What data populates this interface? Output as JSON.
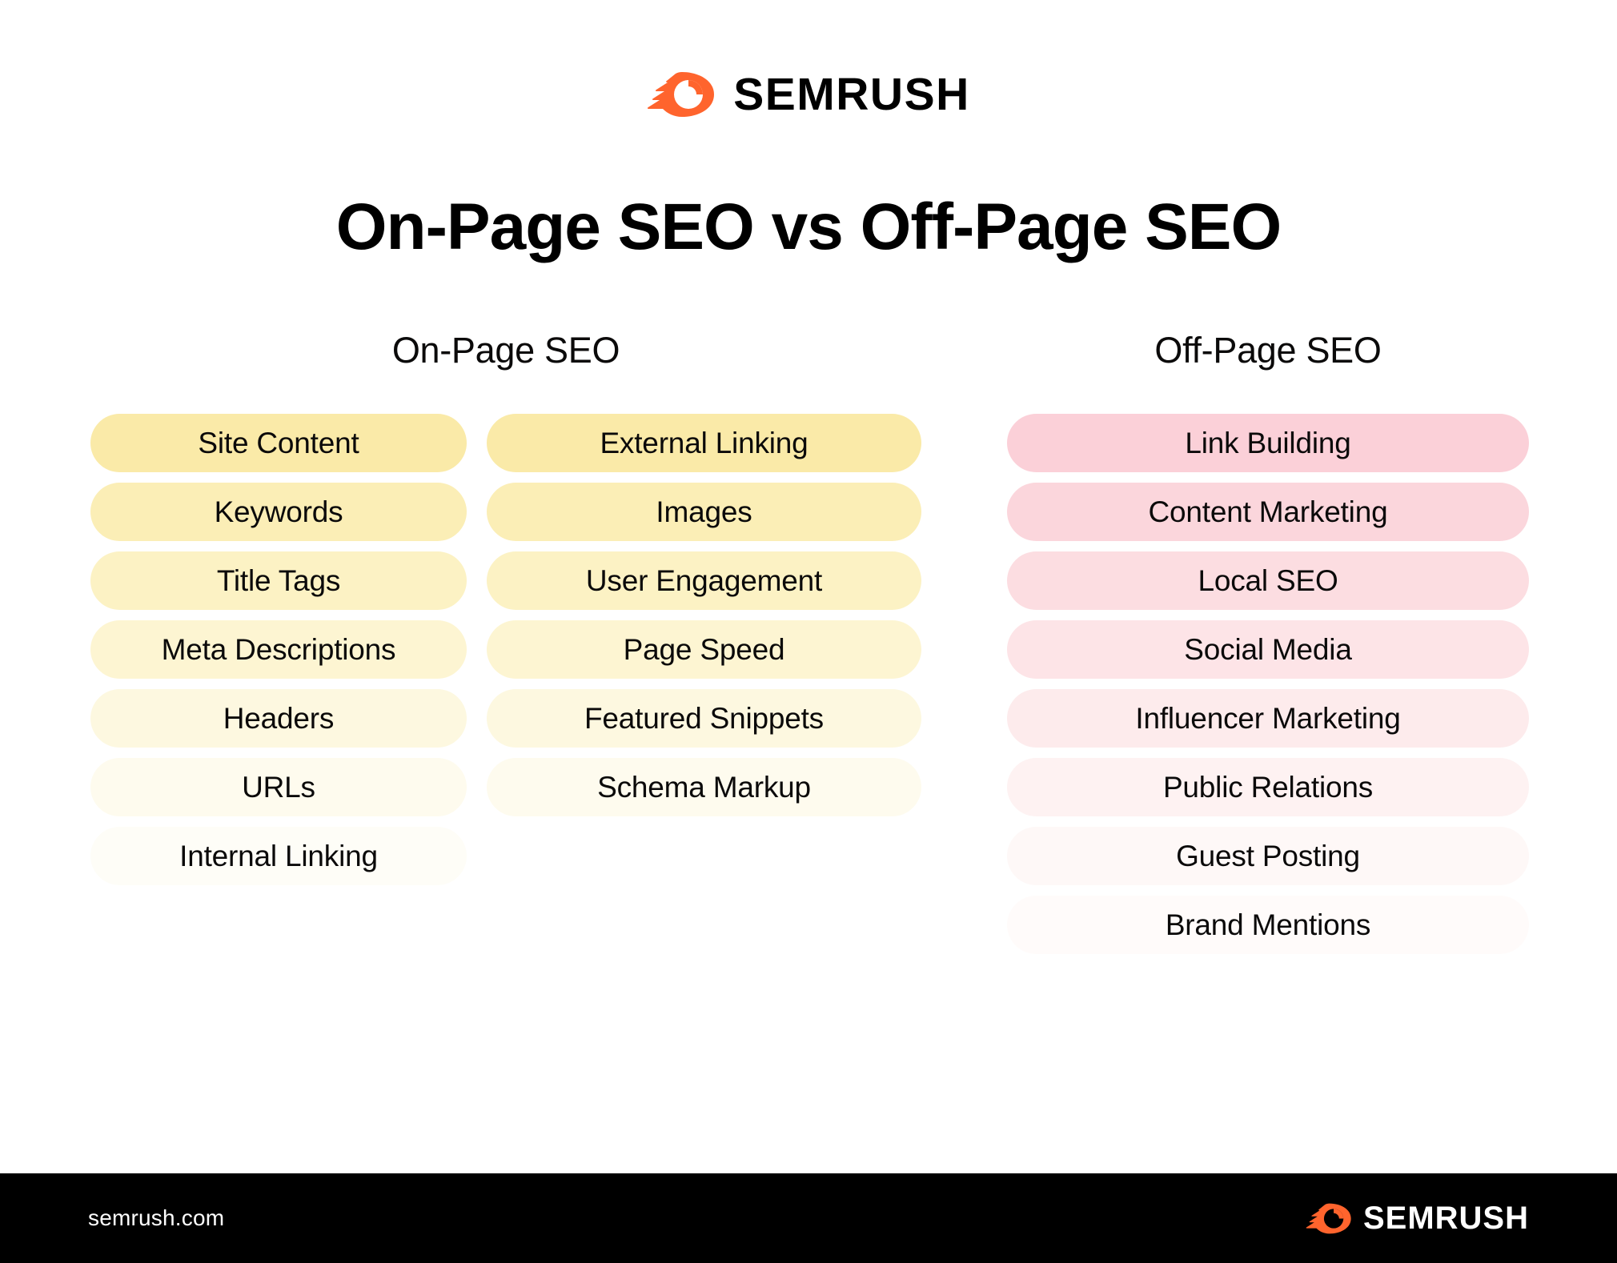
{
  "brand": {
    "name": "SEMRUSH",
    "icon": "semrush-comet-icon",
    "accent_color": "#ff642d"
  },
  "title": "On-Page SEO vs Off-Page SEO",
  "columns": [
    {
      "heading": "On-Page SEO",
      "heading_span": 2,
      "groups": [
        {
          "items": [
            {
              "label": "Site Content",
              "color": "#faeaa8"
            },
            {
              "label": "Keywords",
              "color": "#fbeeb6"
            },
            {
              "label": "Title Tags",
              "color": "#fcf2c4"
            },
            {
              "label": "Meta Descriptions",
              "color": "#fdf5d2"
            },
            {
              "label": "Headers",
              "color": "#fdf8e0"
            },
            {
              "label": "URLs",
              "color": "#fefbee"
            },
            {
              "label": "Internal Linking",
              "color": "#fefdf7"
            }
          ]
        },
        {
          "items": [
            {
              "label": "External Linking",
              "color": "#faeaa8"
            },
            {
              "label": "Images",
              "color": "#fbeeb6"
            },
            {
              "label": "User Engagement",
              "color": "#fcf2c4"
            },
            {
              "label": "Page Speed",
              "color": "#fdf5d2"
            },
            {
              "label": "Featured Snippets",
              "color": "#fdf8e0"
            },
            {
              "label": "Schema Markup",
              "color": "#fefbee"
            }
          ]
        }
      ]
    },
    {
      "heading": "Off-Page SEO",
      "heading_span": 1,
      "groups": [
        {
          "items": [
            {
              "label": "Link Building",
              "color": "#fbd0d8"
            },
            {
              "label": "Content Marketing",
              "color": "#fbd6dc"
            },
            {
              "label": "Local SEO",
              "color": "#fcdde1"
            },
            {
              "label": "Social Media",
              "color": "#fde4e7"
            },
            {
              "label": "Influencer Marketing",
              "color": "#fdebec"
            },
            {
              "label": "Public Relations",
              "color": "#fef2f2"
            },
            {
              "label": "Guest Posting",
              "color": "#fef8f7"
            },
            {
              "label": "Brand Mentions",
              "color": "#fffbfa"
            }
          ]
        }
      ]
    }
  ],
  "footer": {
    "url": "semrush.com",
    "brand": "SEMRUSH"
  }
}
